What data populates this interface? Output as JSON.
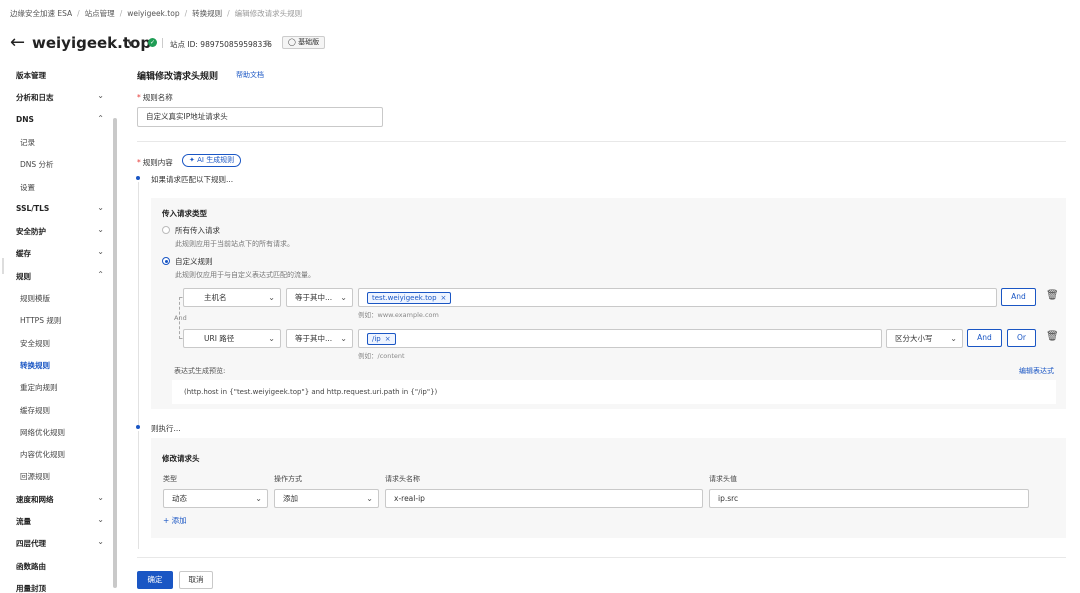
{
  "breadcrumb": [
    "边缘安全加速 ESA",
    "站点管理",
    "weiyigeek.top",
    "转换规则",
    "编辑修改请求头规则"
  ],
  "header": {
    "site_name": "weiyigeek.top",
    "site_id_label": "站点 ID:",
    "site_id": "989750859598336",
    "plan": "基础版"
  },
  "sidebar": {
    "items": [
      {
        "label": "版本管理",
        "type": "parent",
        "chevron": ""
      },
      {
        "label": "分析和日志",
        "type": "parent",
        "chevron": "down"
      },
      {
        "label": "DNS",
        "type": "parent",
        "chevron": "up"
      },
      {
        "label": "记录",
        "type": "child",
        "chevron": ""
      },
      {
        "label": "DNS 分析",
        "type": "child",
        "chevron": ""
      },
      {
        "label": "设置",
        "type": "child",
        "chevron": ""
      },
      {
        "label": "SSL/TLS",
        "type": "parent",
        "chevron": "down"
      },
      {
        "label": "安全防护",
        "type": "parent",
        "chevron": "down"
      },
      {
        "label": "缓存",
        "type": "parent",
        "chevron": "down"
      },
      {
        "label": "规则",
        "type": "parent",
        "chevron": "up"
      },
      {
        "label": "规则模版",
        "type": "child",
        "chevron": ""
      },
      {
        "label": "HTTPS 规则",
        "type": "child",
        "chevron": ""
      },
      {
        "label": "安全规则",
        "type": "child",
        "chevron": ""
      },
      {
        "label": "转换规则",
        "type": "child",
        "chevron": "",
        "active": true
      },
      {
        "label": "重定向规则",
        "type": "child",
        "chevron": ""
      },
      {
        "label": "缓存规则",
        "type": "child",
        "chevron": ""
      },
      {
        "label": "网络优化规则",
        "type": "child",
        "chevron": ""
      },
      {
        "label": "内容优化规则",
        "type": "child",
        "chevron": ""
      },
      {
        "label": "回源规则",
        "type": "child",
        "chevron": ""
      },
      {
        "label": "速度和网络",
        "type": "parent",
        "chevron": "down"
      },
      {
        "label": "流量",
        "type": "parent",
        "chevron": "down"
      },
      {
        "label": "四层代理",
        "type": "parent",
        "chevron": "down"
      },
      {
        "label": "函数路由",
        "type": "parent",
        "chevron": ""
      },
      {
        "label": "用量封顶",
        "type": "parent",
        "chevron": ""
      }
    ]
  },
  "form": {
    "title": "编辑修改请求头规则",
    "help_link": "帮助文档",
    "rule_name_label": "规则名称",
    "rule_name_value": "自定义真实IP地址请求头",
    "rule_content_label": "规则内容",
    "ai_button": "AI 生成规则",
    "step_if": "如果请求匹配以下规则...",
    "incoming_type_label": "传入请求类型",
    "radio_all_label": "所有传入请求",
    "radio_all_desc": "此规则应用于当前站点下的所有请求。",
    "radio_custom_label": "自定义规则",
    "radio_custom_desc": "此规则仅应用于与自定义表达式匹配的流量。",
    "and_connector": "And",
    "conditions": [
      {
        "field": "主机名",
        "operator": "等于其中...",
        "tag": "test.weiyigeek.top",
        "hint": "例如：www.example.com",
        "case": ""
      },
      {
        "field": "URI 路径",
        "operator": "等于其中...",
        "tag": "/ip",
        "hint": "例如：/content",
        "case": "区分大小写"
      }
    ],
    "btn_and": "And",
    "btn_or": "Or",
    "expr_preview_label": "表达式生成预览:",
    "edit_expr_link": "编辑表达式",
    "expression": "(http.host in {\"test.weiyigeek.top\"} and http.request.uri.path in {\"/ip\"})",
    "step_then": "则执行...",
    "modify_header_title": "修改请求头",
    "col_type": "类型",
    "col_op": "操作方式",
    "col_name": "请求头名称",
    "col_value": "请求头值",
    "header_row": {
      "type": "动态",
      "op": "添加",
      "name": "x-real-ip",
      "value": "ip.src"
    },
    "add_link": "+ 添加",
    "confirm_button": "确定",
    "cancel_button": "取消"
  },
  "colors": {
    "primary": "#1a56c4",
    "status_ok": "#1f9d55",
    "required": "#e53935"
  }
}
